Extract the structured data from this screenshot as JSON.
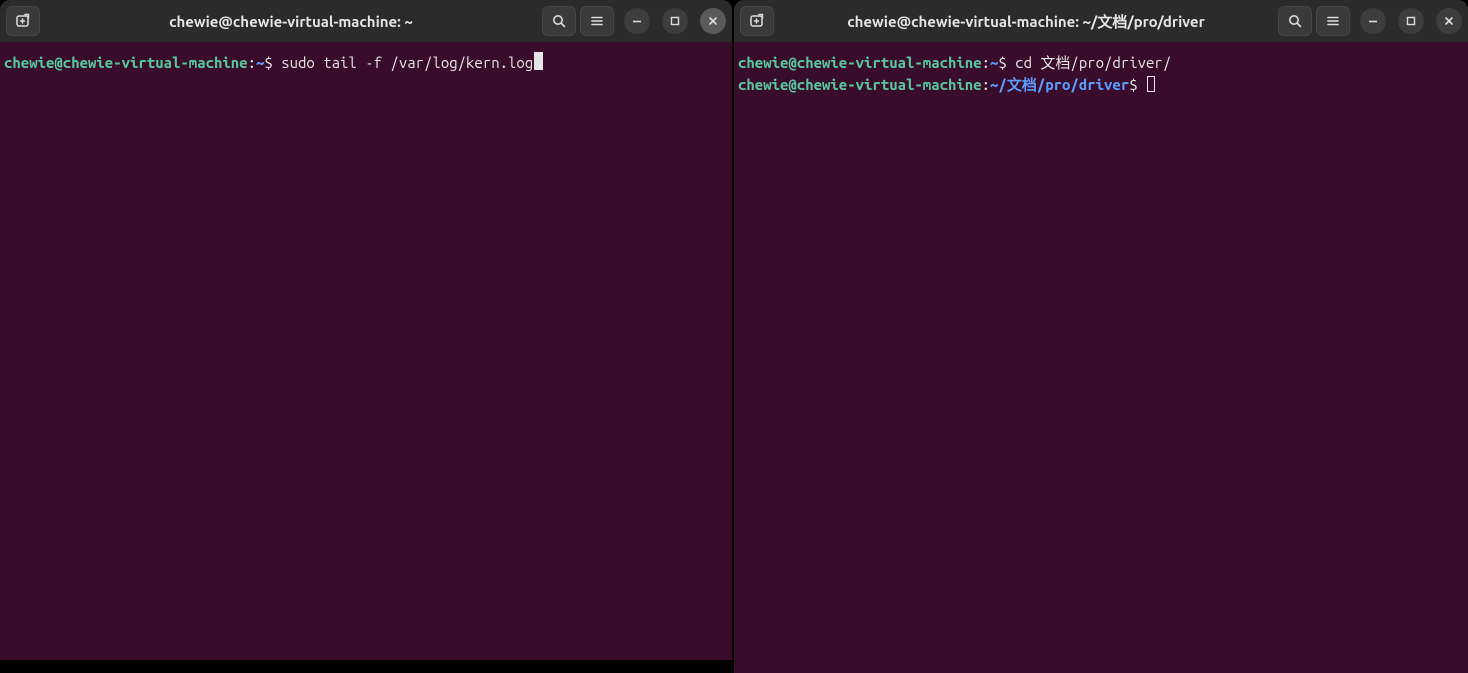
{
  "left": {
    "title": "chewie@chewie-virtual-machine: ~",
    "lines": [
      {
        "userhost": "chewie@chewie-virtual-machine",
        "sep": ":",
        "path": "~",
        "dollar": "$ ",
        "cmd": "sudo tail -f /var/log/kern.log",
        "cursor": "solid"
      }
    ],
    "active": true
  },
  "right": {
    "title": "chewie@chewie-virtual-machine: ~/文档/pro/driver",
    "lines": [
      {
        "userhost": "chewie@chewie-virtual-machine",
        "sep": ":",
        "path": "~",
        "dollar": "$ ",
        "cmd": "cd 文档/pro/driver/",
        "cursor": ""
      },
      {
        "userhost": "chewie@chewie-virtual-machine",
        "sep": ":",
        "path": "~/文档/pro/driver",
        "dollar": "$ ",
        "cmd": "",
        "cursor": "hollow"
      }
    ],
    "active": false
  },
  "icons": {
    "new_tab": "new-tab-icon",
    "search": "search-icon",
    "menu": "hamburger-icon",
    "minimize": "minimize-icon",
    "maximize": "maximize-icon",
    "close": "close-icon"
  }
}
